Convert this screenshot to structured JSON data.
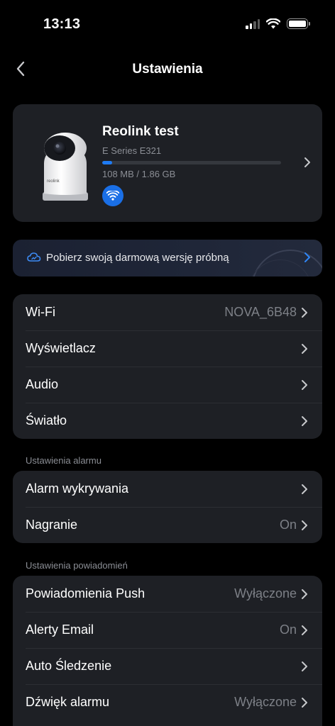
{
  "status_bar": {
    "time": "13:13",
    "signal_icon": "cellular-signal-icon",
    "wifi_icon": "wifi-icon",
    "battery_icon": "battery-icon"
  },
  "nav": {
    "title": "Ustawienia",
    "back_icon": "chevron-left-icon"
  },
  "device": {
    "name": "Reolink test",
    "model": "E Series E321",
    "storage_text": "108 MB / 1.86 GB",
    "storage_used_fraction": 0.057,
    "connection_icon": "wifi-icon"
  },
  "trial_banner": {
    "icon": "cloud-icon",
    "text": "Pobierz swoją darmową wersję próbną"
  },
  "network_group": {
    "rows": [
      {
        "label": "Wi-Fi",
        "value": "NOVA_6B48"
      },
      {
        "label": "Wyświetlacz",
        "value": ""
      },
      {
        "label": "Audio",
        "value": ""
      },
      {
        "label": "Światło",
        "value": ""
      }
    ]
  },
  "alarm_section": {
    "header": "Ustawienia alarmu",
    "rows": [
      {
        "label": "Alarm wykrywania",
        "value": ""
      },
      {
        "label": "Nagranie",
        "value": "On"
      }
    ]
  },
  "notifications_section": {
    "header": "Ustawienia powiadomień",
    "rows": [
      {
        "label": "Powiadomienia Push",
        "value": "Wyłączone"
      },
      {
        "label": "Alerty Email",
        "value": "On"
      },
      {
        "label": "Auto Śledzenie",
        "value": ""
      },
      {
        "label": "Dźwięk alarmu",
        "value": "Wyłączone"
      }
    ]
  },
  "colors": {
    "background": "#000000",
    "card": "#1e2025",
    "accent": "#1e7bf4",
    "secondary_text": "#7d8087"
  }
}
